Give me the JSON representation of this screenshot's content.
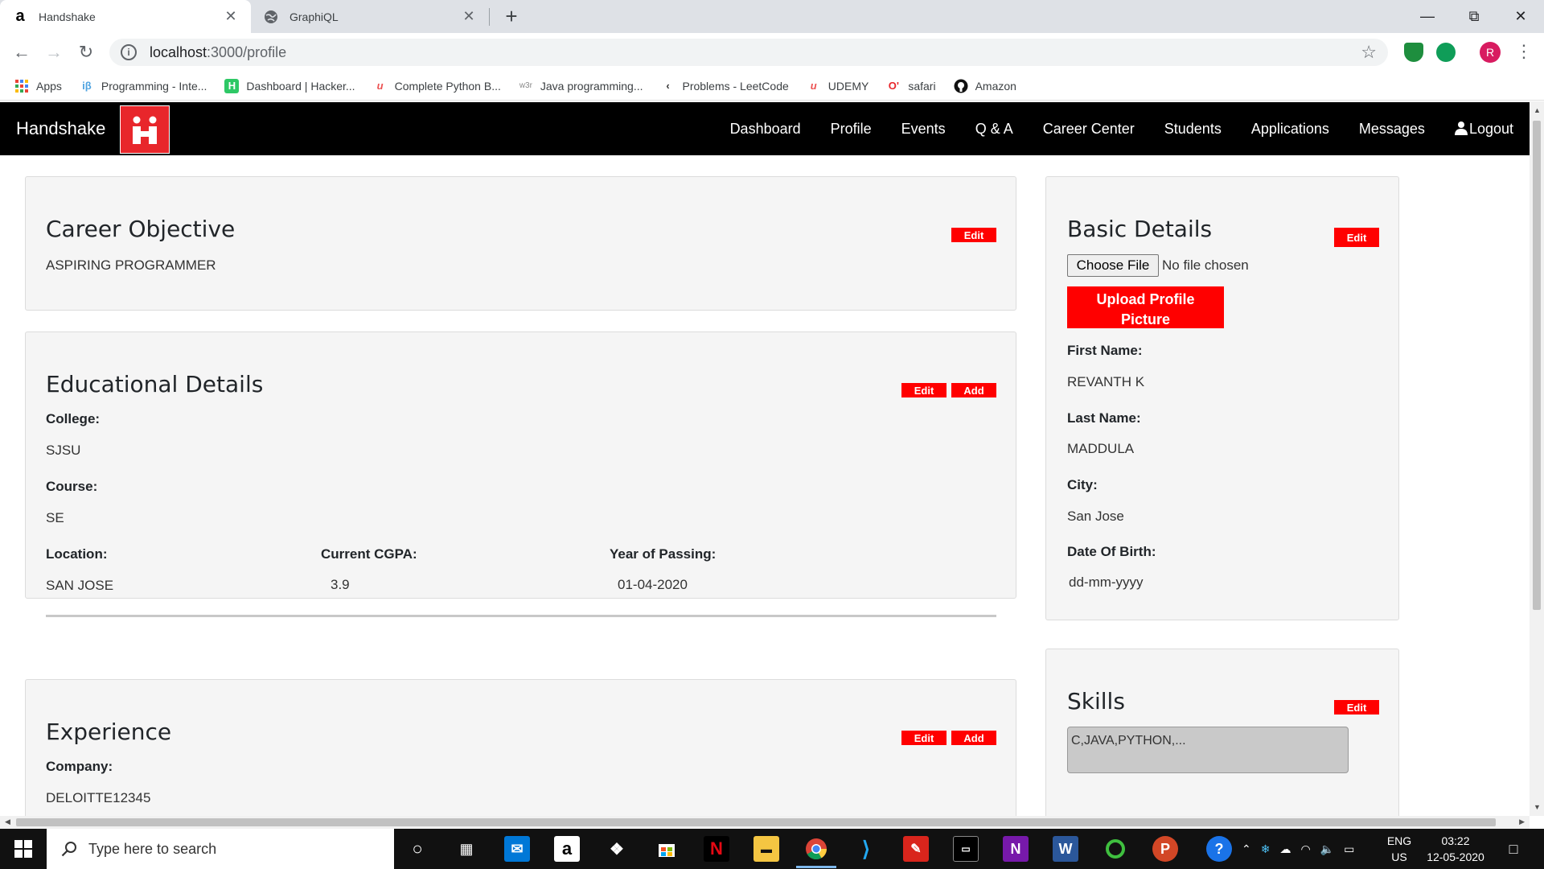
{
  "browser": {
    "tabs": [
      {
        "title": "Handshake",
        "favicon": "amazon-a",
        "active": true
      },
      {
        "title": "GraphiQL",
        "favicon": "globe",
        "active": false
      }
    ],
    "url_host": "localhost",
    "url_rest": ":3000/profile",
    "profile_initial": "R",
    "bookmarks": [
      {
        "label": "Apps",
        "icon": "apps-grid-icon",
        "color": "#1a73e8"
      },
      {
        "label": "Programming - Inte...",
        "icon": "ib-icon",
        "color": "#4fa3e0"
      },
      {
        "label": "Dashboard | Hacker...",
        "icon": "hackerrank-icon",
        "color": "#2ec866"
      },
      {
        "label": "Complete Python B...",
        "icon": "udemy-icon",
        "color": "#ec5252"
      },
      {
        "label": "Java programming...",
        "icon": "w3r-icon",
        "color": "#888888"
      },
      {
        "label": "Problems - LeetCode",
        "icon": "leetcode-icon",
        "color": "#f89f1b"
      },
      {
        "label": "UDEMY",
        "icon": "udemy-icon",
        "color": "#ec5252"
      },
      {
        "label": "safari",
        "icon": "safari-icon",
        "color": "#e8262b"
      },
      {
        "label": "Amazon",
        "icon": "github-icon",
        "color": "#111111"
      }
    ]
  },
  "app": {
    "brand": "Handshake",
    "accent": "#ff0000",
    "nav": [
      "Dashboard",
      "Profile",
      "Events",
      "Q & A",
      "Career Center",
      "Students",
      "Applications",
      "Messages"
    ],
    "logout": "Logout"
  },
  "career": {
    "title": "Career Objective",
    "edit": "Edit",
    "objective": "ASPIRING PROGRAMMER"
  },
  "education": {
    "title": "Educational Details",
    "edit": "Edit",
    "add": "Add",
    "college_label": "College:",
    "college": "SJSU",
    "course_label": "Course:",
    "course": "SE",
    "location_label": "Location:",
    "location": "SAN JOSE",
    "cgpa_label": "Current CGPA:",
    "cgpa": "3.9",
    "year_label": "Year of Passing:",
    "year": "01-04-2020"
  },
  "experience": {
    "title": "Experience",
    "edit": "Edit",
    "add": "Add",
    "company_label": "Company:",
    "company": "DELOITTE12345"
  },
  "basic": {
    "title": "Basic Details",
    "edit": "Edit",
    "choose_file": "Choose File",
    "no_file": "No file chosen",
    "upload_line1": "Upload Profile",
    "upload_line2": "Picture",
    "first_name_label": "First Name:",
    "first_name": "REVANTH K",
    "last_name_label": "Last Name:",
    "last_name": "MADDULA",
    "city_label": "City:",
    "city": "San Jose",
    "dob_label": "Date Of Birth:",
    "dob": "dd-mm-yyyy"
  },
  "skills": {
    "title": "Skills",
    "edit": "Edit",
    "value": "C,JAVA,PYTHON,..."
  },
  "taskbar": {
    "search_placeholder": "Type here to search",
    "lang_top": "ENG",
    "lang_bottom": "US",
    "time": "03:22",
    "date": "12-05-2020"
  }
}
